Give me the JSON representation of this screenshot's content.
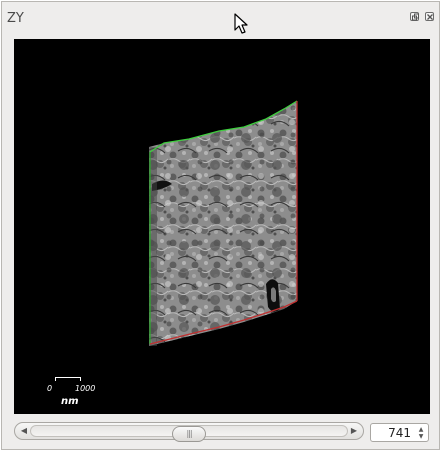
{
  "window": {
    "title": "ZY"
  },
  "title_buttons": {
    "float_icon": "float-icon",
    "close_icon": "close-icon"
  },
  "scale_bar": {
    "min_label": "0",
    "max_label": "1000",
    "unit": "nm"
  },
  "slice": {
    "value": "741",
    "scroll_fraction": 0.5
  },
  "colors": {
    "viewport_bg": "#000000",
    "top_edge": "#3fcf3f",
    "left_edge": "#2ea82e",
    "right_edge": "#c03030",
    "bottom_edge": "#c03030"
  },
  "icons": {
    "scroll_left": "chevron-left-icon",
    "scroll_right": "chevron-right-icon",
    "scroll_grip": "grip-icon",
    "spin_up": "chevron-up-icon",
    "spin_down": "chevron-down-icon",
    "cursor": "mouse-pointer-icon"
  }
}
